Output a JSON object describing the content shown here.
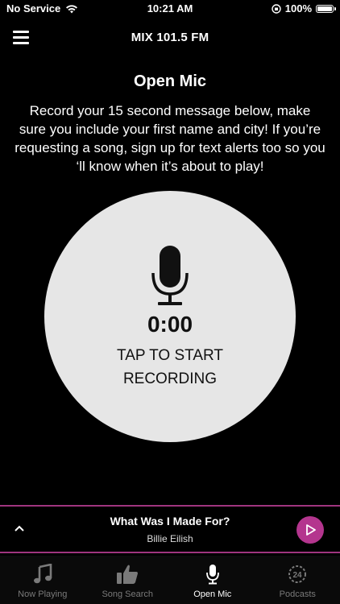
{
  "status_bar": {
    "carrier": "No Service",
    "time": "10:21 AM",
    "battery": "100%"
  },
  "header": {
    "title": "MIX 101.5 FM"
  },
  "main": {
    "title": "Open Mic",
    "instructions": "Record your 15 second message below, make sure you include your first name and city! If you’re requesting a song, sign up for text alerts too so you ‘ll know when it’s about to play!",
    "timer": "0:00",
    "tap_label": "TAP TO START RECORDING"
  },
  "now_playing": {
    "title": "What Was I Made For?",
    "artist": "Billie Eilish"
  },
  "tabs": [
    {
      "label": "Now Playing",
      "icon": "music-note-icon"
    },
    {
      "label": "Song Search",
      "icon": "thumbs-up-icon"
    },
    {
      "label": "Open Mic",
      "icon": "microphone-icon"
    },
    {
      "label": "Podcasts",
      "icon": "podcast-24-icon"
    }
  ],
  "colors": {
    "accent": "#b4358e",
    "border": "#a0357f",
    "circle": "#e6e6e6",
    "inactive_tab": "#7a7a7a"
  }
}
